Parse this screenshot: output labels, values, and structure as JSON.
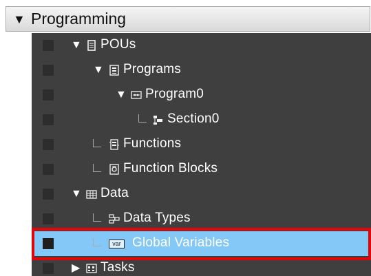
{
  "header": {
    "title": "Programming",
    "expander": "▼"
  },
  "tree": {
    "items": [
      {
        "label": "POUs",
        "expander": "▼",
        "icon": "pou-folder-icon"
      },
      {
        "label": "Programs",
        "expander": "▼",
        "icon": "programs-icon"
      },
      {
        "label": "Program0",
        "expander": "▼",
        "icon": "program-icon"
      },
      {
        "label": "Section0",
        "expander": "",
        "icon": "section-icon"
      },
      {
        "label": "Functions",
        "expander": "",
        "icon": "functions-icon"
      },
      {
        "label": "Function Blocks",
        "expander": "",
        "icon": "function-blocks-icon"
      },
      {
        "label": "Data",
        "expander": "▼",
        "icon": "data-icon"
      },
      {
        "label": "Data Types",
        "expander": "",
        "icon": "data-types-icon"
      },
      {
        "label": "Global Variables",
        "expander": "",
        "icon": "global-variables-icon",
        "icon_text": "var"
      },
      {
        "label": "Tasks",
        "expander": "▶",
        "icon": "tasks-icon"
      }
    ]
  },
  "colors": {
    "tree_background": "#3f3f3f",
    "selected_row": "#84c8f8",
    "highlight_border": "#e0070a",
    "header_background": "#e6e6e6"
  }
}
